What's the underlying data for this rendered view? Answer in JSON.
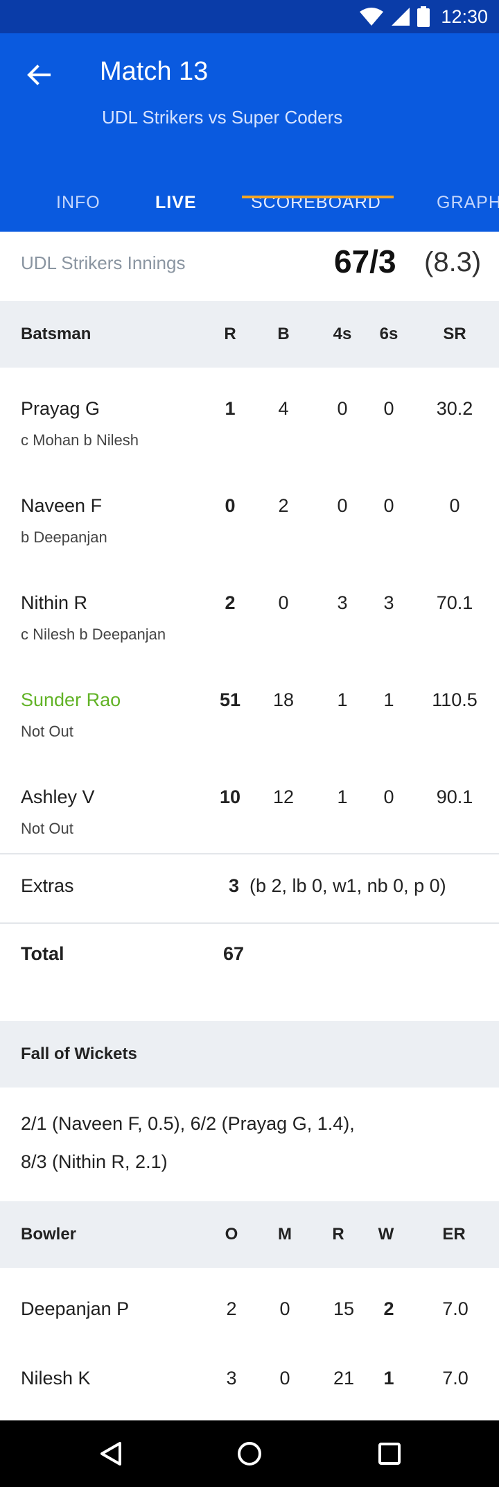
{
  "status_bar": {
    "time": "12:30",
    "icons": [
      "wifi-icon",
      "signal-icon",
      "battery-icon"
    ]
  },
  "header": {
    "title": "Match 13",
    "subtitle": "UDL Strikers vs Super Coders",
    "tabs": [
      {
        "label": "INFO"
      },
      {
        "label": "LIVE"
      },
      {
        "label": "SCOREBOARD"
      },
      {
        "label": "GRAPH"
      }
    ]
  },
  "innings": {
    "team": "UDL Strikers Innings",
    "score": "67/3",
    "overs": "(8.3)"
  },
  "batting": {
    "columns": [
      "Batsman",
      "R",
      "B",
      "4s",
      "6s",
      "SR"
    ],
    "rows": [
      {
        "name": "Prayag G",
        "dismissal": "c Mohan b Nilesh",
        "R": "1",
        "B": "4",
        "4s": "0",
        "6s": "0",
        "SR": "30.2"
      },
      {
        "name": "Naveen F",
        "dismissal": "b Deepanjan",
        "R": "0",
        "B": "2",
        "4s": "0",
        "6s": "0",
        "SR": "0"
      },
      {
        "name": "Nithin R",
        "dismissal": "c Nilesh b Deepanjan",
        "R": "2",
        "B": "0",
        "4s": "3",
        "6s": "3",
        "SR": "70.1"
      },
      {
        "name": "Sunder Rao",
        "dismissal": "Not Out",
        "R": "51",
        "B": "18",
        "4s": "1",
        "6s": "1",
        "SR": "110.5"
      },
      {
        "name": "Ashley V",
        "dismissal": "Not Out",
        "R": "10",
        "B": "12",
        "4s": "1",
        "6s": "0",
        "SR": "90.1"
      }
    ],
    "highlight_color": "#62b327"
  },
  "extras": {
    "label": "Extras",
    "value": "3",
    "detail": "(b 2, lb 0, w1, nb 0, p 0)"
  },
  "total": {
    "label": "Total",
    "value": "67"
  },
  "fall_of_wickets": {
    "title": "Fall of Wickets",
    "line1": "2/1 (Naveen F, 0.5), 6/2 (Prayag G, 1.4),",
    "line2": "8/3 (Nithin R, 2.1)"
  },
  "bowling": {
    "columns": [
      "Bowler",
      "O",
      "M",
      "R",
      "W",
      "ER"
    ],
    "rows": [
      {
        "name": "Deepanjan P",
        "O": "2",
        "M": "0",
        "R": "15",
        "W": "2",
        "ER": "7.0"
      },
      {
        "name": "Nilesh K",
        "O": "3",
        "M": "0",
        "R": "21",
        "W": "1",
        "ER": "7.0"
      }
    ]
  },
  "colors": {
    "primary": "#0a5adf",
    "status_bar": "#0a3ca8",
    "tab_indicator": "#f5a623",
    "section_bg": "#eceff3"
  },
  "nav_bar": {
    "icons": [
      "back-icon",
      "home-icon",
      "recents-icon"
    ]
  }
}
